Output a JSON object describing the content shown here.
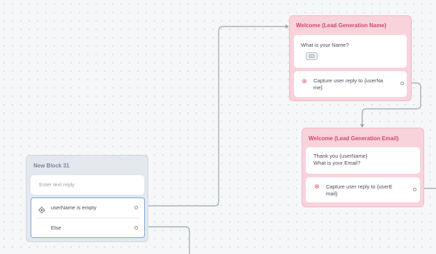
{
  "blocks": {
    "name_block": {
      "title": "Welcome (Lead Generation Name)",
      "question": "What is your Name?",
      "capture_line1": "Capture user reply to {userNa",
      "capture_line2": "me}"
    },
    "email_block": {
      "title": "Welcome (Lead Generation Email)",
      "message_line1": "Thank you {userName}",
      "message_line2": "What is your Email?",
      "capture_line1": "Capture user reply to {userE",
      "capture_line2": "mail}"
    },
    "new_block": {
      "title": "New Block 31",
      "input_placeholder": "Enter text reply",
      "condition_label": "userName is empty",
      "else_label": "Else"
    }
  },
  "icons": {
    "name_chip": "keyboard-icon",
    "capture": "capture-icon",
    "condition": "condition-icon"
  },
  "colors": {
    "pink_block": "#f9d3dc",
    "pink_title": "#d0486a",
    "grey_block": "#e3e7ee",
    "wire": "#9aa3af",
    "condition_border": "#7aa6d8"
  }
}
